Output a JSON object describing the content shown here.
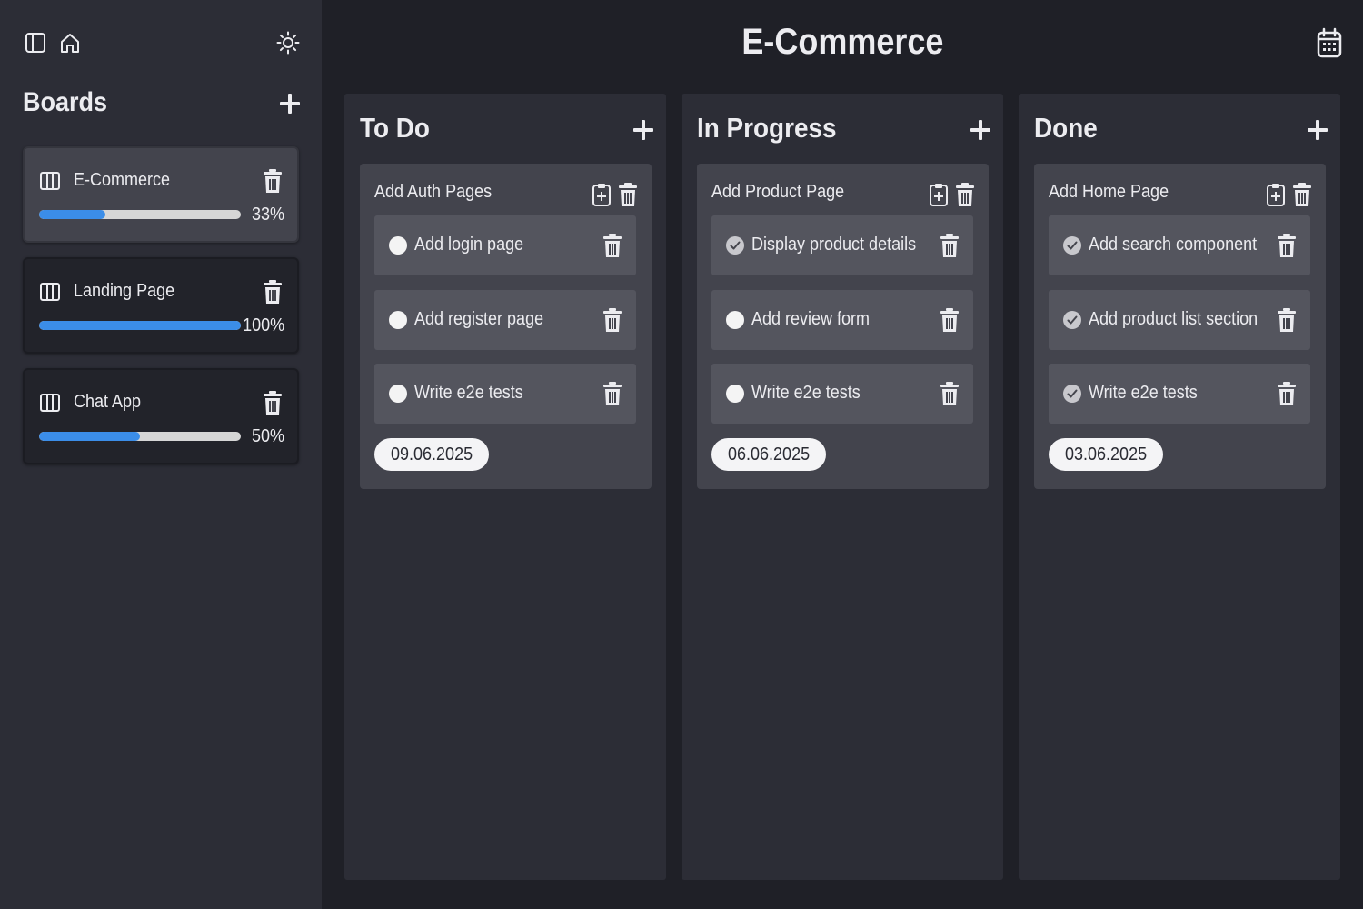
{
  "sidebar": {
    "title": "Boards",
    "boards": [
      {
        "name": "E-Commerce",
        "progress": 33,
        "progress_label": "33%",
        "active": true
      },
      {
        "name": "Landing Page",
        "progress": 100,
        "progress_label": "100%",
        "active": false
      },
      {
        "name": "Chat App",
        "progress": 50,
        "progress_label": "50%",
        "active": false
      }
    ]
  },
  "header": {
    "title": "E-Commerce"
  },
  "columns": [
    {
      "title": "To Do",
      "group": {
        "title": "Add Auth Pages",
        "date": "09.06.2025",
        "tasks": [
          {
            "text": "Add login page",
            "done": false
          },
          {
            "text": "Add register page",
            "done": false
          },
          {
            "text": "Write e2e tests",
            "done": false
          }
        ]
      }
    },
    {
      "title": "In Progress",
      "group": {
        "title": "Add Product Page",
        "date": "06.06.2025",
        "tasks": [
          {
            "text": "Display product details",
            "done": true
          },
          {
            "text": "Add review form",
            "done": false
          },
          {
            "text": "Write e2e tests",
            "done": false
          }
        ]
      }
    },
    {
      "title": "Done",
      "group": {
        "title": "Add Home Page",
        "date": "03.06.2025",
        "tasks": [
          {
            "text": "Add search component",
            "done": true
          },
          {
            "text": "Add product list section",
            "done": true
          },
          {
            "text": "Write e2e tests",
            "done": true
          }
        ]
      }
    }
  ],
  "colors": {
    "background": "#1f2027",
    "sidebar": "#2c2d36",
    "progress_fill": "#3b8de8",
    "progress_track": "#d6d6d6"
  },
  "icons": [
    "sidebar-toggle-icon",
    "home-icon",
    "sun-icon",
    "plus-icon",
    "board-icon",
    "trash-icon",
    "clipboard-plus-icon",
    "calendar-icon",
    "check-icon"
  ]
}
